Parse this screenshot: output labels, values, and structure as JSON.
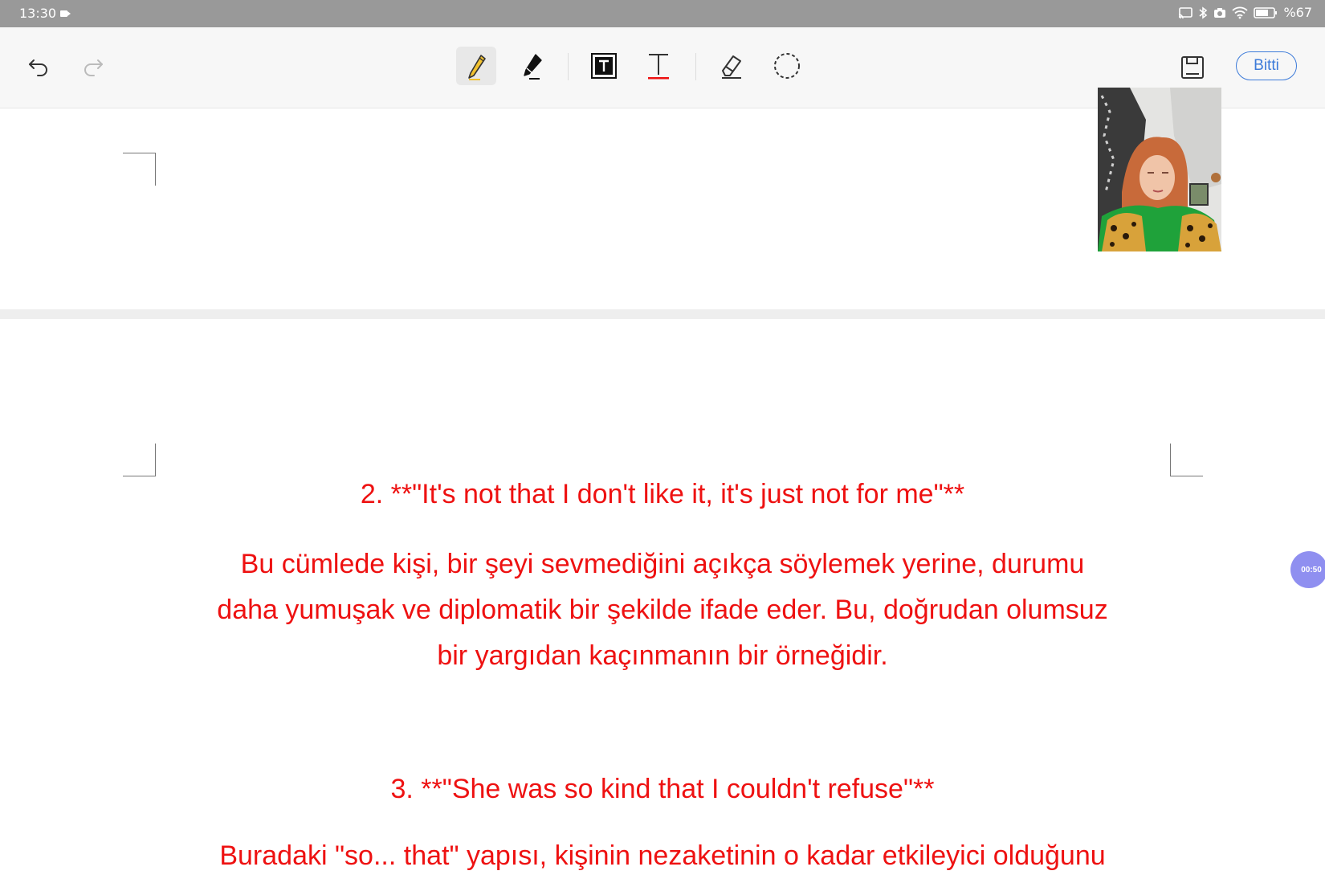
{
  "status_bar": {
    "time": "13:30",
    "battery_text": "%67",
    "icons": [
      "cast-icon",
      "bluetooth-icon",
      "camera-icon",
      "wifi-icon",
      "battery-icon"
    ]
  },
  "toolbar": {
    "undo_icon": "undo-icon",
    "redo_icon": "redo-icon",
    "tools": [
      "pencil-icon",
      "highlighter-icon",
      "text-box-icon",
      "text-cursor-icon",
      "eraser-icon",
      "lasso-icon"
    ],
    "save_icon": "save-icon",
    "done_label": "Bitti",
    "accent": "#3d7bd9"
  },
  "recording_timer": "00:50",
  "document": {
    "text_color": "#ee1111",
    "item2_heading": "2. **\"It's not that I don't like it, it's just not for me\"**",
    "item2_lines": [
      "Bu cümlede kişi, bir şeyi sevmediğini açıkça söylemek yerine, durumu",
      "daha yumuşak ve diplomatik bir şekilde ifade eder. Bu, doğrudan olumsuz",
      "bir yargıdan kaçınmanın bir örneğidir."
    ],
    "item3_heading": "3. **\"She was so kind that I couldn't refuse\"**",
    "item3_partial_line": "Buradaki \"so... that\" yapısı, kişinin nezaketinin o kadar etkileyici olduğunu"
  }
}
